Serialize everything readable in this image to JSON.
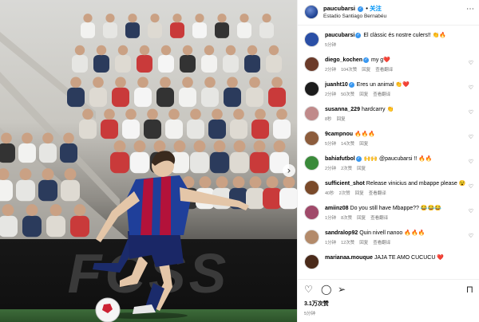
{
  "post": {
    "username": "paucubarsi",
    "follow_label": "关注",
    "location": "Estadio Santiago Bernabéu",
    "likes": "3.1万次赞",
    "time_ago": "5分钟"
  },
  "photo": {
    "board_text": "FCSS"
  },
  "comments": [
    {
      "user": "paucubarsi",
      "verified": true,
      "text": "El clàssic és nostre culers!! 👏🔥",
      "time": "5分钟",
      "likes": "",
      "reply": "",
      "translate": ""
    },
    {
      "user": "diego_kochen",
      "verified": true,
      "text": "my g❤️",
      "time": "2分钟",
      "likes": "104次赞",
      "reply": "回复",
      "translate": "查看翻译"
    },
    {
      "user": "juanht10",
      "verified": true,
      "text": "Eres un animal 👏❤️",
      "time": "2分钟",
      "likes": "50次赞",
      "reply": "回复",
      "translate": "查看翻译"
    },
    {
      "user": "susanna_229",
      "verified": false,
      "text": "hardcarry 👏",
      "time": "8秒",
      "likes": "",
      "reply": "回复",
      "translate": ""
    },
    {
      "user": "9campnou",
      "verified": false,
      "text": "🔥🔥🔥",
      "time": "5分钟",
      "likes": "14次赞",
      "reply": "回复",
      "translate": ""
    },
    {
      "user": "bahiafutbol",
      "verified": true,
      "text": "🙌🙌 @paucubarsi !! 🔥🔥",
      "time": "2分钟",
      "likes": "2次赞",
      "reply": "回复",
      "translate": ""
    },
    {
      "user": "sufficient_shot",
      "verified": false,
      "text": "Release vinicius and mbappe please 😵😵",
      "time": "40秒",
      "likes": "2次赞",
      "reply": "回复",
      "translate": "查看翻译"
    },
    {
      "user": "amiinz08",
      "verified": false,
      "text": "Do you still have Mbappe?? 😂😂😂",
      "time": "1分钟",
      "likes": "8次赞",
      "reply": "回复",
      "translate": "查看翻译"
    },
    {
      "user": "sandralop92",
      "verified": false,
      "text": "Quin nivell nanoo 🔥🔥🔥",
      "time": "1分钟",
      "likes": "12次赞",
      "reply": "回复",
      "translate": "查看翻译"
    },
    {
      "user": "marianaa.mouque",
      "verified": false,
      "text": "JAJA TE AMO CUCUCU ❤️",
      "time": "",
      "likes": "",
      "reply": "",
      "translate": ""
    }
  ],
  "icons": {
    "more": "more-icon",
    "like": "heart-icon",
    "comment": "comment-icon",
    "share": "share-icon",
    "save": "bookmark-icon",
    "next": "chevron-right-icon"
  },
  "colors": {
    "accent": "#0095f6",
    "verified": "#3897f0",
    "kit_blue": "#1f3f9a",
    "kit_red": "#b3123a"
  }
}
